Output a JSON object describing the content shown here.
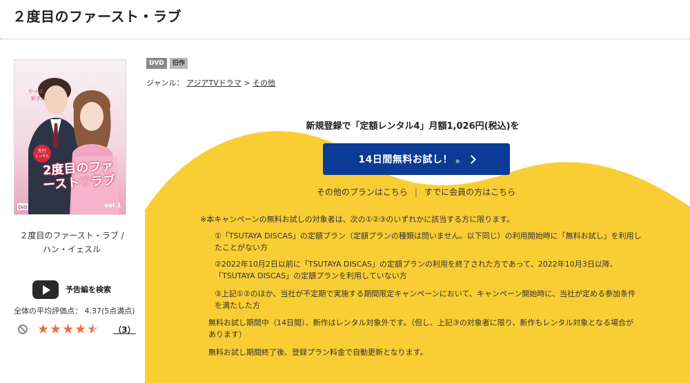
{
  "page_title": "２度目のファースト・ラブ",
  "cover": {
    "title_text": "2度目のファースト♡ラブ",
    "caption_top": "やっぱ、\n好き。。。",
    "badge": "先行\nレンタル",
    "dvd_mark": "DVD",
    "vol": "vol.1"
  },
  "product_name": "２度目のファースト・ラブ / ハン・イェスル",
  "trailer_label": "予告編を検索",
  "rating": {
    "average_text": "全体の平均評価点： 4.37(5点満点)",
    "value": 4.37,
    "max": 5,
    "review_count": "（3）"
  },
  "badges": [
    "DVD",
    "旧作"
  ],
  "genre": {
    "label": "ジャンル：",
    "primary": "アジアTVドラマ",
    "sep": " > ",
    "secondary": "その他"
  },
  "promo": {
    "headline": "新規登録で「定額レンタル4」月額1,026円(税込)を",
    "cta_label": "14日間無料お試し！",
    "cta_note": "※",
    "other_plans": "その他のプランはこちら",
    "separator": "|",
    "members": "すでに会員の方はこちら"
  },
  "notes": {
    "intro": "※本キャンペーンの無料お試しの対象者は、次の①②③のいずれかに該当する方に限ります。",
    "item1": "①「TSUTAYA DISCAS」の定額プラン（定額プランの種類は問いません。以下同じ）の利用開始時に「無料お試し」を利用したことがない方",
    "item2": "②2022年10月2日以前に「TSUTAYA DISCAS」の定額プランの利用を終了された方であって、2022年10月3日以降、「TSUTAYA DISCAS」の定額プランを利用していない方",
    "item3": "③上記①②のほか、当社が不定期で実施する期間限定キャンペーンにおいて、キャンペーン開始時に、当社が定める参加条件を満たした方",
    "trial_note": "無料お試し期間中（14日間）、新作はレンタル対象外です。（但し、上記③の対象者に限り、新作もレンタル対象となる場合があります）",
    "renewal_note": "無料お試し期間終了後、登録プラン料金で自動更新となります。"
  },
  "colors": {
    "promo_yellow": "#f9cd34",
    "cta_blue": "#0b3b94",
    "star": "#f26d3d"
  }
}
